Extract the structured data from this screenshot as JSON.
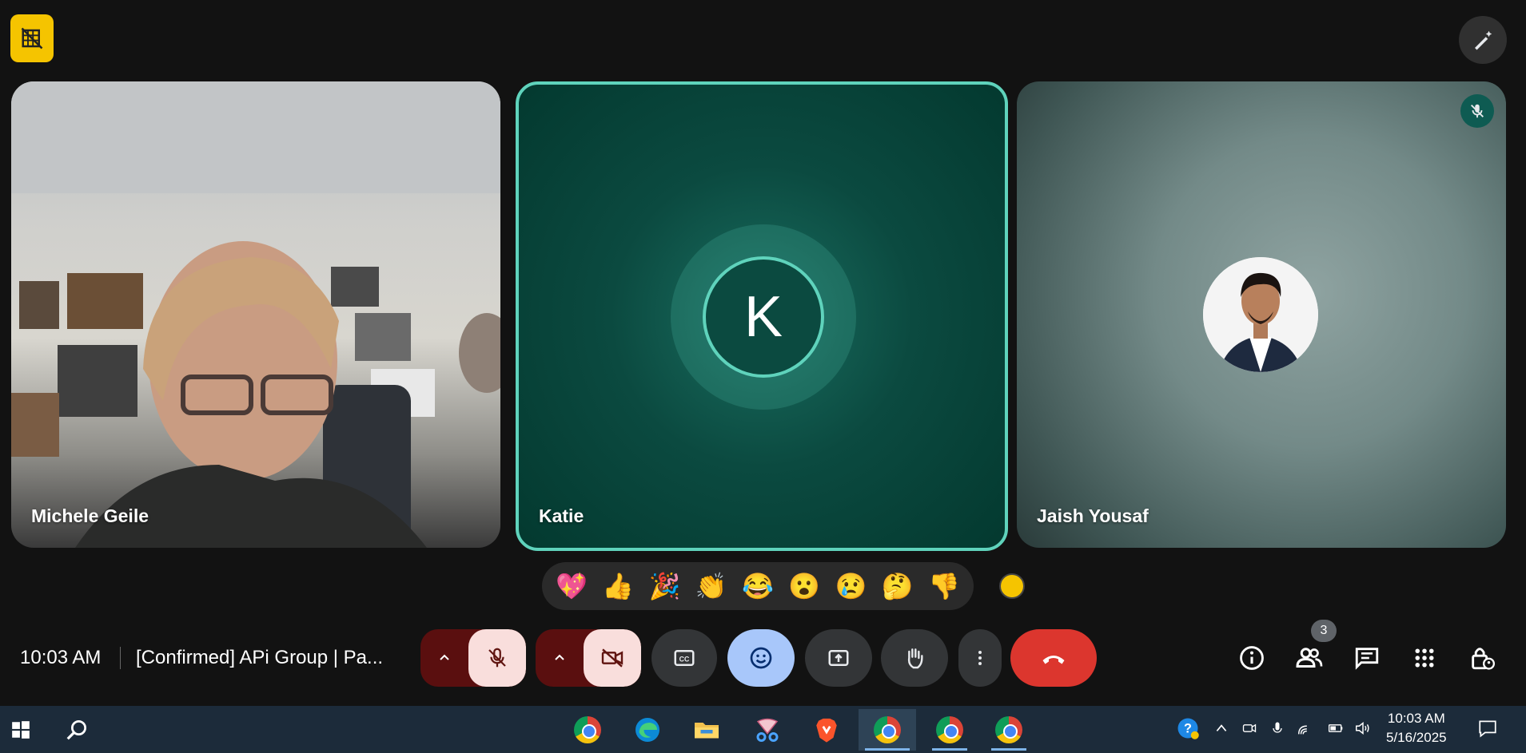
{
  "tiles": [
    {
      "name": "Michele Geile"
    },
    {
      "name": "Katie",
      "initial": "K"
    },
    {
      "name": "Jaish Yousaf"
    }
  ],
  "reactions": [
    "💖",
    "👍",
    "🎉",
    "👏",
    "😂",
    "😮",
    "😢",
    "🤔",
    "👎"
  ],
  "meeting": {
    "time": "10:03 AM",
    "title": "[Confirmed] APi Group | Pa..."
  },
  "participants_count": "3",
  "taskbar": {
    "time": "10:03 AM",
    "date": "5/16/2025"
  },
  "colors": {
    "accent_teal": "#5fd3bc",
    "end_call": "#dc362e",
    "reaction_selected": "#a8c7fa",
    "badge_yellow": "#f5c400"
  }
}
